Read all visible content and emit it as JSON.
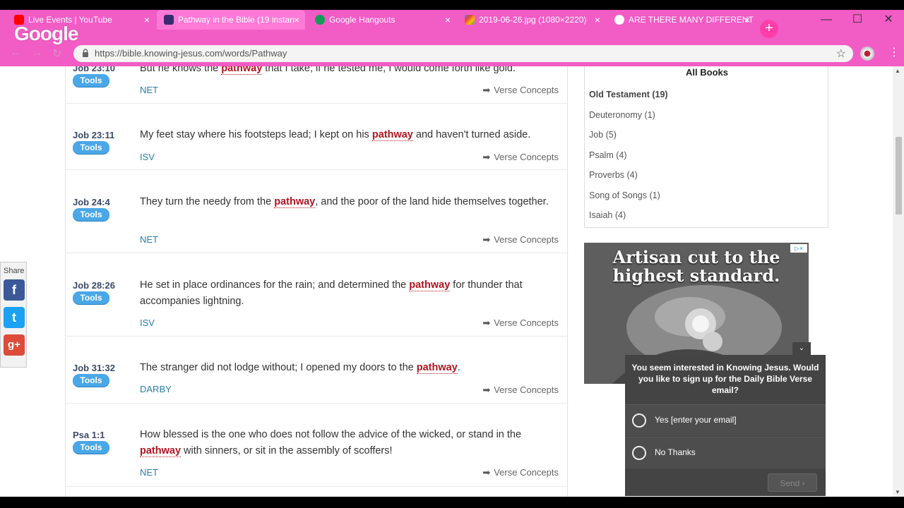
{
  "browser": {
    "tabs": [
      {
        "title": "Live Events | YouTube",
        "favicon_color": "#ff0000"
      },
      {
        "title": "Pathway in the Bible (19 instan",
        "favicon_color": "#3b2a6e"
      },
      {
        "title": "Google Hangouts",
        "favicon_color": "#0f9d58"
      },
      {
        "title": "2019-06-26.jpg (1080×2220)",
        "favicon_color": "#ff9800"
      },
      {
        "title": "ARE THERE MANY DIFFERENT",
        "favicon_color": "#ffffff"
      }
    ],
    "url": "https://bible.knowing-jesus.com/words/Pathway",
    "google_logo": "Google",
    "theme_color": "#f25cc5"
  },
  "verses": [
    {
      "ref": "Job 23:10",
      "tools": "Tools",
      "parts": [
        "But he knows the ",
        "pathway",
        " that I take; if he tested me, I would come forth like gold."
      ],
      "translation": "NET",
      "concepts": "Verse Concepts"
    },
    {
      "ref": "Job 23:11",
      "tools": "Tools",
      "parts": [
        "My feet stay where his footsteps lead; I kept on his ",
        "pathway",
        " and haven't turned aside."
      ],
      "translation": "ISV",
      "concepts": "Verse Concepts"
    },
    {
      "ref": "Job 24:4",
      "tools": "Tools",
      "parts": [
        "They turn the needy from the ",
        "pathway",
        ", and the poor of the land hide themselves together."
      ],
      "translation": "NET",
      "concepts": "Verse Concepts"
    },
    {
      "ref": "Job 28:26",
      "tools": "Tools",
      "parts": [
        "He set in place ordinances for the rain; and determined the ",
        "pathway",
        " for thunder that accompanies lightning."
      ],
      "translation": "ISV",
      "concepts": "Verse Concepts"
    },
    {
      "ref": "Job 31:32",
      "tools": "Tools",
      "parts": [
        "The stranger did not lodge without; I opened my doors to the ",
        "pathway",
        "."
      ],
      "translation": "DARBY",
      "concepts": "Verse Concepts"
    },
    {
      "ref": "Psa 1:1",
      "tools": "Tools",
      "parts": [
        "How blessed is the one who does not follow the advice of the wicked, or stand in the ",
        "pathway",
        " with sinners, or sit in the assembly of scoffers!"
      ],
      "translation": "NET",
      "concepts": "Verse Concepts"
    }
  ],
  "sidebar": {
    "title": "All Books",
    "books": [
      "Old Testament (19)",
      "Deuteronomy (1)",
      "Job (5)",
      "Psalm (4)",
      "Proverbs (4)",
      "Song of Songs (1)",
      "Isaiah (4)"
    ]
  },
  "ad": {
    "text": "Artisan cut to the highest standard.",
    "badge": "▷×"
  },
  "share": {
    "label": "Share",
    "buttons": [
      {
        "name": "facebook",
        "glyph": "f",
        "color": "#3b5998"
      },
      {
        "name": "twitter",
        "glyph": "t",
        "color": "#1da1f2"
      },
      {
        "name": "google-plus",
        "glyph": "g+",
        "color": "#dd4b39"
      }
    ]
  },
  "popup": {
    "question": "You seem interested in Knowing Jesus. Would you like to sign up for the Daily Bible Verse email?",
    "options": [
      "Yes [enter your email]",
      "No Thanks"
    ],
    "send": "Send ›"
  }
}
